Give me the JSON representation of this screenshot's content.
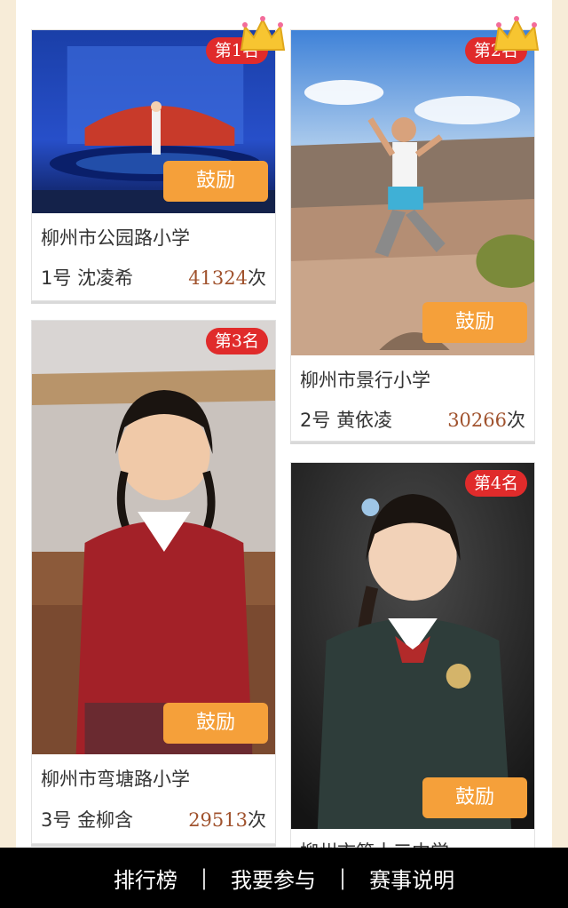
{
  "bottom_nav": {
    "ranking": "排行榜",
    "join": "我要参与",
    "rules": "赛事说明",
    "separator": "|"
  },
  "encourage_label": "鼓励",
  "votes_suffix": "次",
  "entries": [
    {
      "rank": "第1名",
      "school": "柳州市公园路小学",
      "number": "1号",
      "name": "沈凌希",
      "votes": "41324"
    },
    {
      "rank": "第2名",
      "school": "柳州市景行小学",
      "number": "2号",
      "name": "黄依凌",
      "votes": "30266"
    },
    {
      "rank": "第3名",
      "school": "柳州市弯塘路小学",
      "number": "3号",
      "name": "金柳含",
      "votes": "29513"
    },
    {
      "rank": "第4名",
      "school": "柳州市第十三中学",
      "number": "",
      "name": "",
      "votes": ""
    }
  ],
  "colors": {
    "page_bg": "#f7ecd8",
    "badge": "#e02b2b",
    "button": "#f5a03a",
    "vote_number": "#a0522d",
    "bottom_bar": "#000000"
  },
  "icons": [
    "crown-icon"
  ]
}
